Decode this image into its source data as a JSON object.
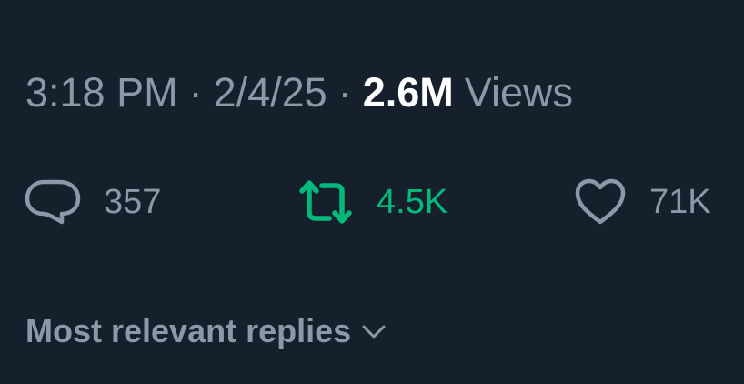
{
  "tweet_meta": {
    "time": "3:18 PM",
    "separator": "·",
    "date": "2/4/25",
    "views_count": "2.6M",
    "views_label": "Views"
  },
  "actions": {
    "replies": {
      "icon": "reply-bubble-icon",
      "count": "357"
    },
    "reposts": {
      "icon": "repost-icon",
      "count": "4.5K",
      "active_color": "#00ba7c"
    },
    "likes": {
      "icon": "heart-outline-icon",
      "count": "71K"
    }
  },
  "replies_sort": {
    "label": "Most relevant replies",
    "icon": "chevron-down-icon"
  },
  "colors": {
    "background": "#16202c",
    "muted_text": "#8b98a5",
    "primary_text": "#ffffff",
    "repost_green": "#00ba7c"
  }
}
